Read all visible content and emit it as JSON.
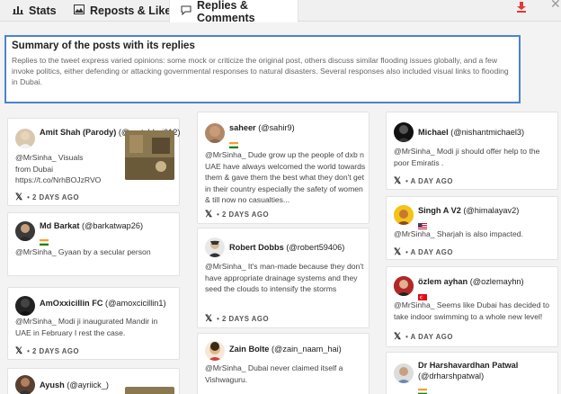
{
  "tabs": [
    {
      "label": "Stats",
      "icon": "bar-chart-icon"
    },
    {
      "label": "Reposts & Likes",
      "icon": "image-icon"
    },
    {
      "label": "Replies & Comments",
      "icon": "chat-icon"
    }
  ],
  "summary": {
    "title": "Summary of the posts with its replies",
    "text": "Replies to the tweet express varied opinions: some mock or criticize the original post, others discuss similar flooding issues globally, and a few invoke politics, either defending or attacking governmental responses to natural disasters. Several responses also included visual links to flooding in Dubai."
  },
  "platform_glyph": "𝕏",
  "colors": {
    "accent": "#4a84cc",
    "download": "#e53935"
  },
  "replies": [
    {
      "name": "Amit Shah (Parody)",
      "handle": "(@motabhai012)",
      "text": "@MrSinha_ Visuals from Dubai https://t.co/NrhBOJzRVO",
      "time": "• 2 DAYS AGO"
    },
    {
      "name": "Md Barkat",
      "handle": "(@barkatwap26)",
      "text": "@MrSinha_ Gyaan by a secular person",
      "time": "• 2 DAYS AGO"
    },
    {
      "name": "AmOxxicillin FC",
      "handle": "(@amoxcicillin1)",
      "text": "@MrSinha_ Modi ji inaugurated Mandir in UAE in February I rest the case.",
      "time": "• 2 DAYS AGO"
    },
    {
      "name": "Ayush",
      "handle": "(@ayriick_)",
      "text": "",
      "time": ""
    },
    {
      "name": "saheer",
      "handle": "(@sahir9)",
      "text": "@MrSinha_ Dude grow up the people of dxb n UAE have always welcomed the world towards them & gave them the best what they don't get in their country especially the safety of women & till now no casualties...",
      "time": "• 2 DAYS AGO"
    },
    {
      "name": "Robert Dobbs",
      "handle": "(@robert59406)",
      "text": "@MrSinha_ It's man-made because they don't have appropriate drainage systems and they seed the clouds to intensify the storms",
      "time": "• 2 DAYS AGO"
    },
    {
      "name": "Zain Bolte",
      "handle": "(@zain_naam_hai)",
      "text": "@MrSinha_ Dubai never claimed itself a Vishwaguru.",
      "time": ""
    },
    {
      "name": "Michael",
      "handle": "(@nishantmichael3)",
      "text": "@MrSinha_ Modi ji should offer help to the poor Emiratis .",
      "time": "• A DAY AGO"
    },
    {
      "name": "Singh A V2",
      "handle": "(@himalayav2)",
      "text": "@MrSinha_ Sharjah is also impacted.",
      "time": "• A DAY AGO"
    },
    {
      "name": "özlem ayhan",
      "handle": "(@ozlemayhn)",
      "text": "@MrSinha_ Seems like Dubai has decided to take indoor swimming to a whole new level!",
      "time": "• A DAY AGO"
    },
    {
      "name": "Dr Harshavardhan Patwal",
      "handle": "(@drharshpatwal)",
      "text": "",
      "time": ""
    }
  ]
}
